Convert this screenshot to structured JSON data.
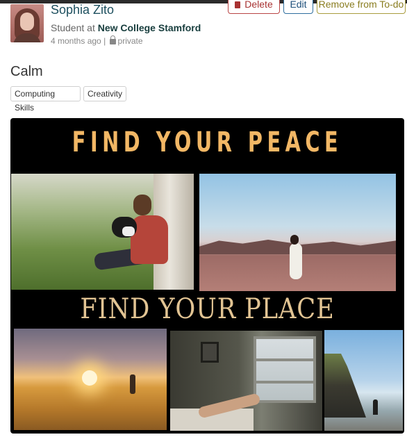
{
  "header": {
    "user_name": "Sophia Zito",
    "role_prefix": "Student at",
    "institution": "New College Stamford",
    "time_ago": "4 months ago",
    "separator": "|",
    "visibility": "private"
  },
  "actions": {
    "delete_label": "Delete",
    "edit_label": "Edit",
    "todo_label": "Remove from To-do"
  },
  "post": {
    "title": "Calm",
    "tags": [
      "Computing Skills",
      "Creativity"
    ]
  },
  "poster": {
    "headline_top": "FIND YOUR PEACE",
    "headline_middle": "FIND YOUR PLACE"
  },
  "colors": {
    "delete": "#a83232",
    "edit": "#1d4f7a",
    "todo": "#8a7d20",
    "headline_top": "#f2b765",
    "headline_middle": "#e2c493"
  },
  "icons": {
    "delete": "trash-icon",
    "visibility": "lock-icon"
  }
}
